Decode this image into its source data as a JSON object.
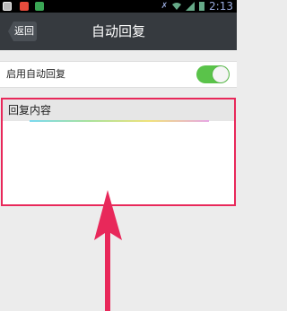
{
  "status_bar": {
    "time": "2:13"
  },
  "title_bar": {
    "back_label": "返回",
    "title": "自动回复"
  },
  "auto_reply": {
    "label": "启用自动回复",
    "enabled": true
  },
  "reply_content": {
    "label": "回复内容",
    "value": ""
  },
  "colors": {
    "toggle_on": "#5ac34a",
    "highlight": "#e8285a",
    "title_bar": "#363a3f"
  }
}
